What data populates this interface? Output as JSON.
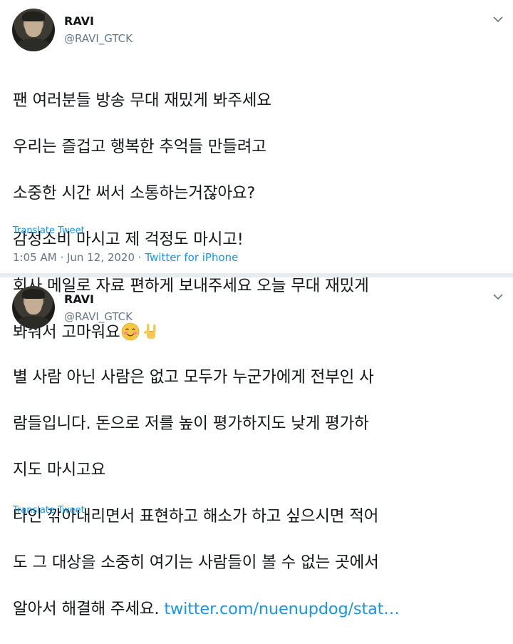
{
  "tweets": [
    {
      "name": "RAVI",
      "handle": "@RAVI_GTCK",
      "lines": [
        "팬 여러분들 방송 무대 재밌게 봐주세요",
        "우리는 즐겁고 행복한 추억들 만들려고",
        "소중한 시간 써서 소통하는거잖아요?",
        "감정소비 마시고 제 걱정도 마시고!",
        "회사 메일로 자료 편하게 보내주세요 오늘 무대 재밌게",
        "봐줘서 고마워요"
      ],
      "emojis": [
        "smiling-face-icon",
        "rock-on-hand-icon"
      ],
      "translate_label": "Translate Tweet",
      "time": "1:05 AM",
      "date": "Jun 12, 2020",
      "source": "Twitter for iPhone"
    },
    {
      "name": "RAVI",
      "handle": "@RAVI_GTCK",
      "lines": [
        "별 사람 아닌 사람은 없고 모두가 누군가에게 전부인 사",
        "람들입니다. 돈으로 저를 높이 평가하지도 낮게 평가하",
        "지도 마시고요",
        "타인 깎아내리면서 표현하고 해소가 하고 싶으시면 적어",
        "도 그 대상을 소중히 여기는 사람들이 볼 수 없는 곳에서",
        "알아서 해결해 주세요."
      ],
      "link": "twitter.com/nuenupdog/stat…",
      "translate_label": "Translate Tweet"
    }
  ],
  "colors": {
    "link": "#1b95e0",
    "muted": "#657786",
    "text": "#14171a",
    "divider": "#e6ecf0"
  }
}
